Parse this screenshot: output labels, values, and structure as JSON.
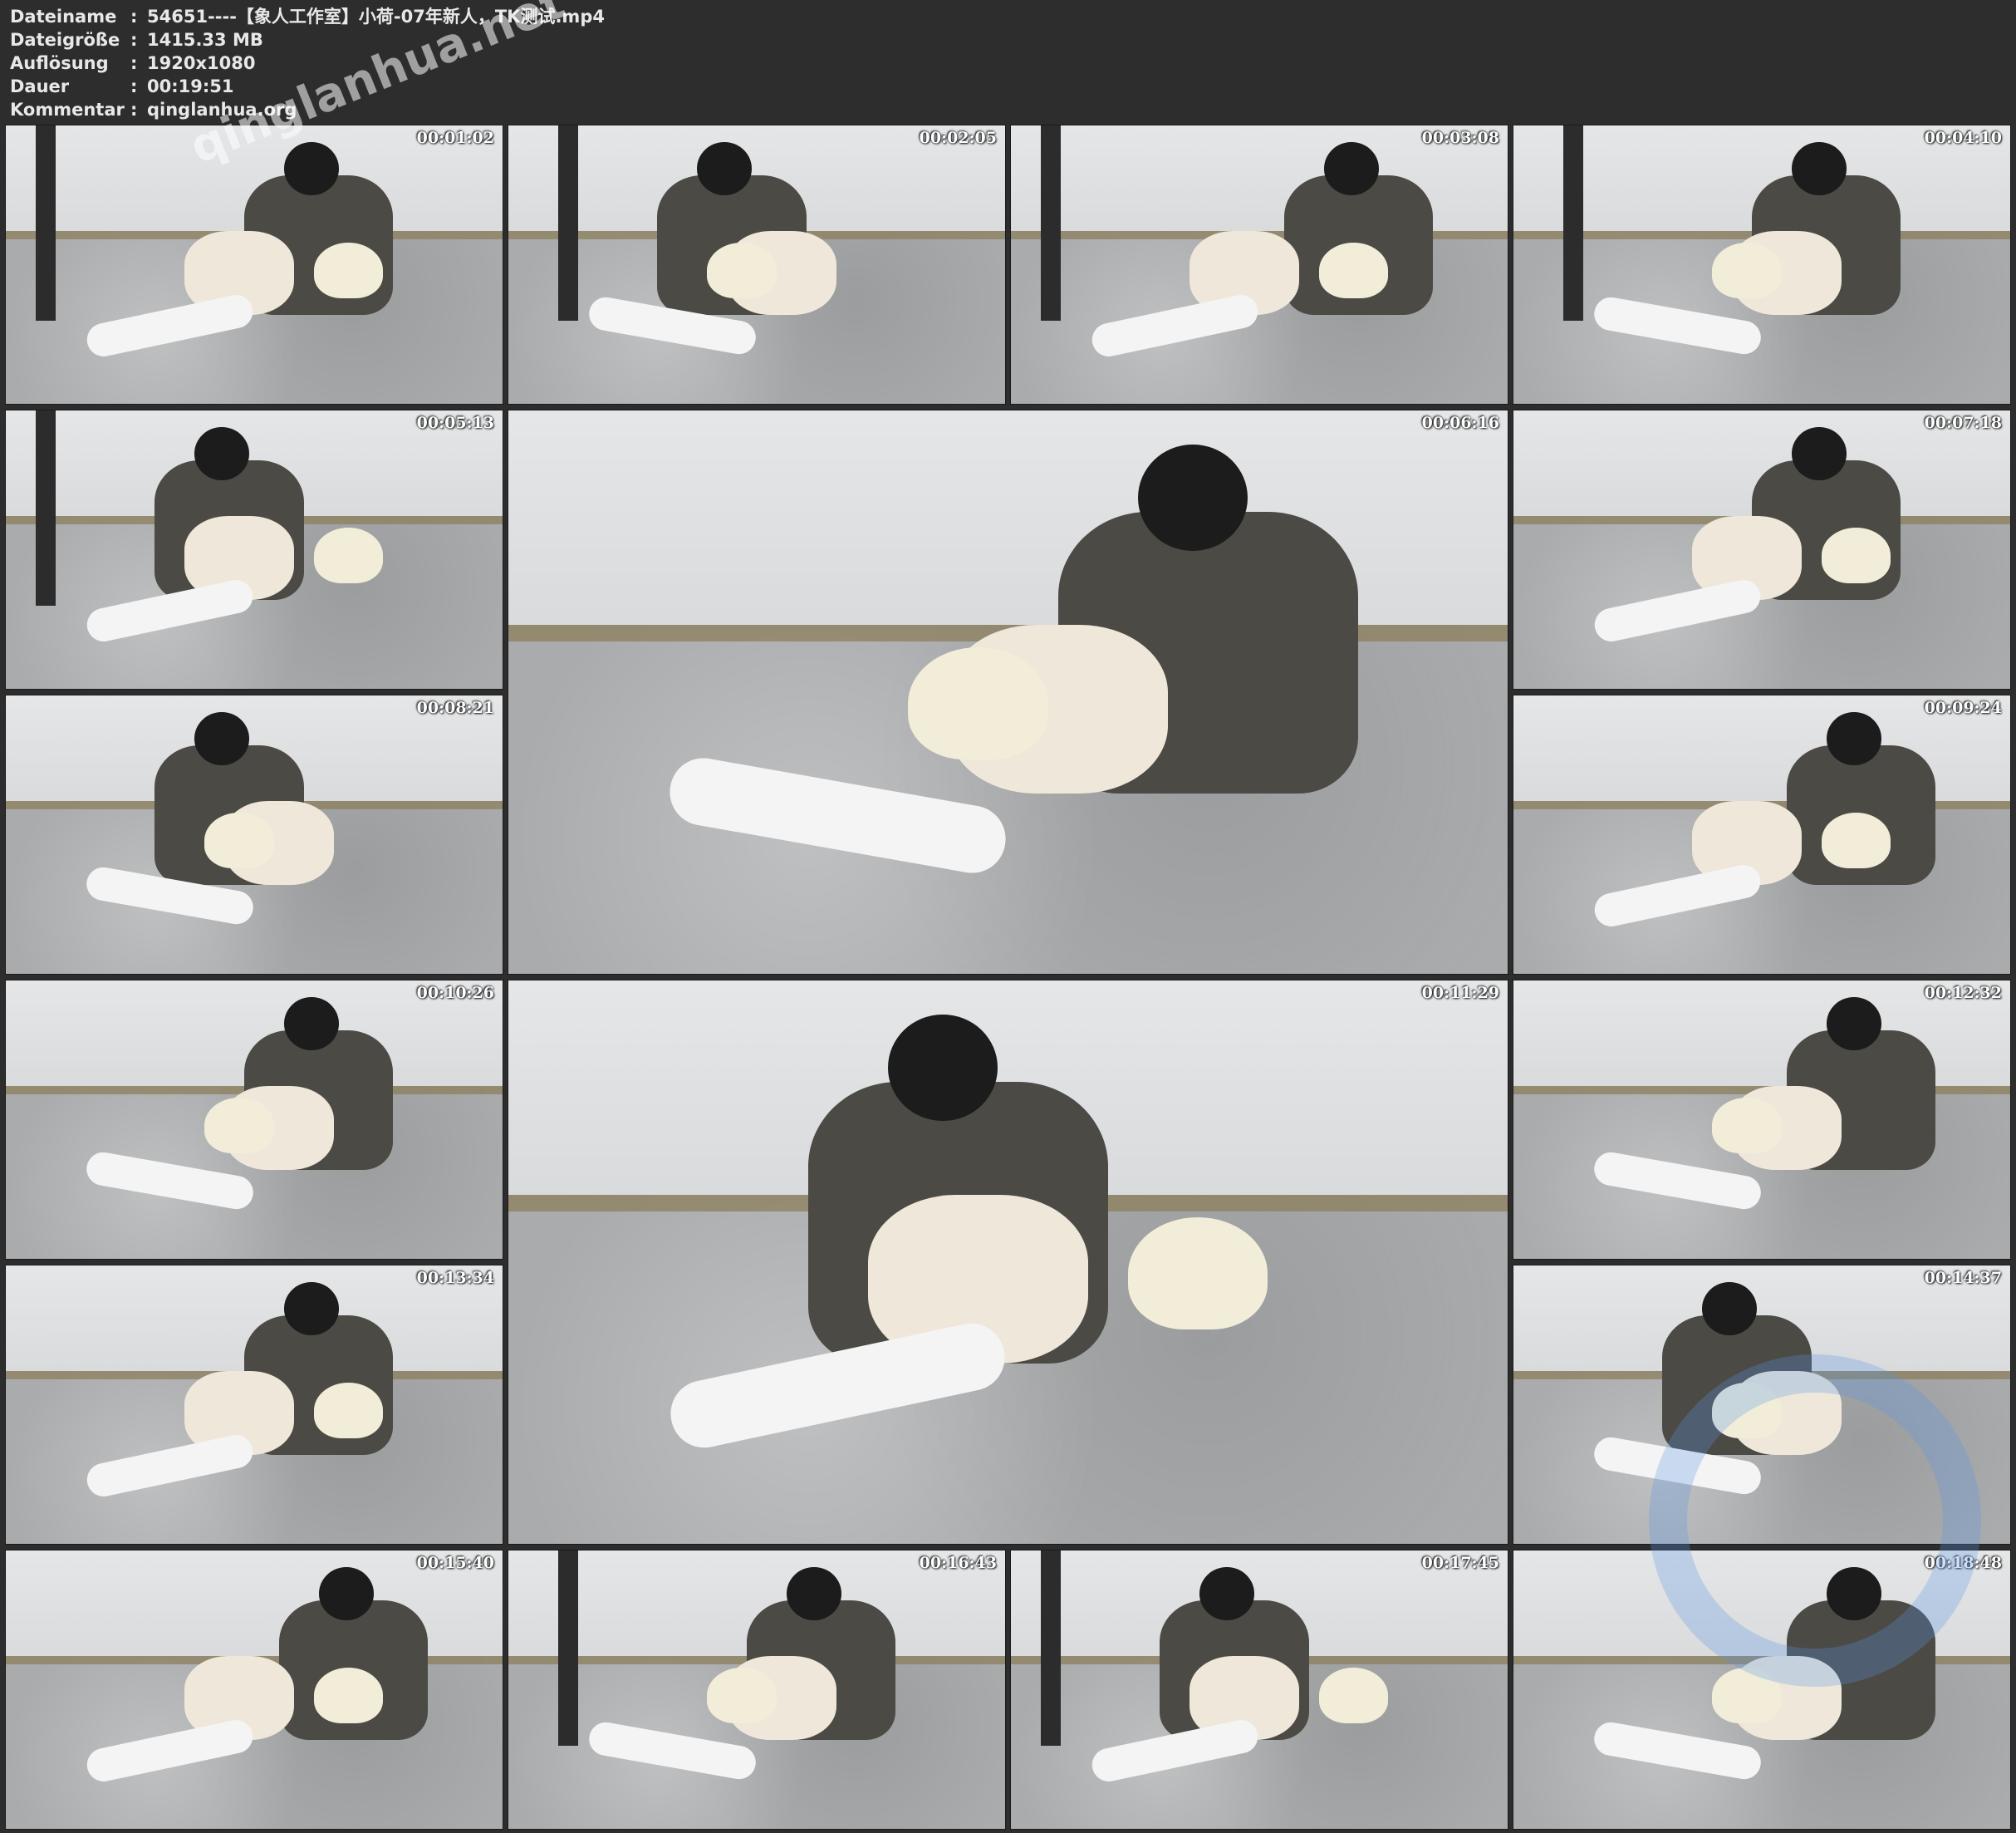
{
  "header": {
    "rows": [
      {
        "label": "Dateiname",
        "value": "54651----【象人工作室】小荷-07年新人，TK测试.mp4"
      },
      {
        "label": "Dateigröße",
        "value": "1415.33 MB"
      },
      {
        "label": "Auflösung",
        "value": "1920x1080"
      },
      {
        "label": "Dauer",
        "value": "00:19:51"
      },
      {
        "label": "Kommentar",
        "value": "qinglanhua.org"
      }
    ],
    "separator": ":"
  },
  "thumbnails": [
    {
      "timestamp": "00:01:02"
    },
    {
      "timestamp": "00:02:05"
    },
    {
      "timestamp": "00:03:08"
    },
    {
      "timestamp": "00:04:10"
    },
    {
      "timestamp": "00:05:13"
    },
    {
      "timestamp": "00:06:16"
    },
    {
      "timestamp": "00:07:18"
    },
    {
      "timestamp": "00:08:21"
    },
    {
      "timestamp": "00:09:24"
    },
    {
      "timestamp": "00:10:26"
    },
    {
      "timestamp": "00:11:29"
    },
    {
      "timestamp": "00:12:32"
    },
    {
      "timestamp": "00:13:34"
    },
    {
      "timestamp": "00:14:37"
    },
    {
      "timestamp": "00:15:40"
    },
    {
      "timestamp": "00:16:43"
    },
    {
      "timestamp": "00:17:45"
    },
    {
      "timestamp": "00:18:48"
    }
  ],
  "watermark_text": "qinglanhua.net"
}
